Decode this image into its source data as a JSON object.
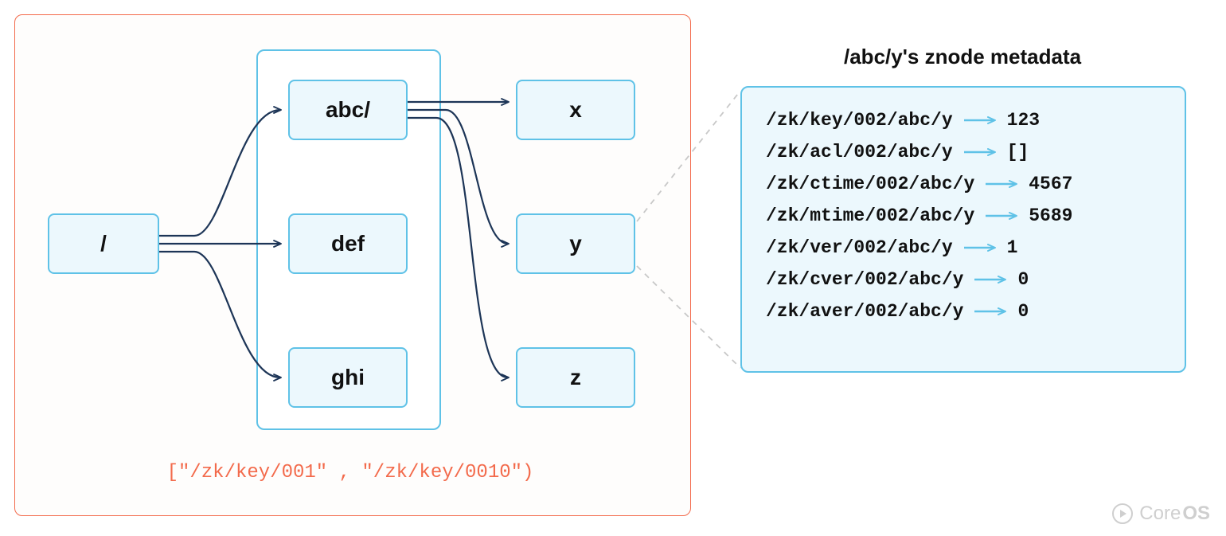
{
  "tree": {
    "root": {
      "label": "/"
    },
    "level1_frame_range": "[\"/zk/key/001\" , \"/zk/key/0010\")",
    "level1": [
      {
        "label": "abc/"
      },
      {
        "label": "def"
      },
      {
        "label": "ghi"
      }
    ],
    "level2": [
      {
        "label": "x"
      },
      {
        "label": "y"
      },
      {
        "label": "z"
      }
    ]
  },
  "metadata": {
    "title": "/abc/y's znode metadata",
    "rows": [
      {
        "key": "/zk/key/002/abc/y",
        "value": "123"
      },
      {
        "key": "/zk/acl/002/abc/y",
        "value": "[]"
      },
      {
        "key": "/zk/ctime/002/abc/y",
        "value": "4567"
      },
      {
        "key": "/zk/mtime/002/abc/y",
        "value": "5689"
      },
      {
        "key": "/zk/ver/002/abc/y",
        "value": "1"
      },
      {
        "key": "/zk/cver/002/abc/y",
        "value": "0"
      },
      {
        "key": "/zk/aver/002/abc/y",
        "value": "0"
      }
    ]
  },
  "branding": {
    "name_prefix": "Core",
    "name_suffix": "OS"
  },
  "colors": {
    "node_border": "#5fc2e7",
    "node_fill": "#ecf8fd",
    "frame_border": "#f36a4b",
    "arrow_dark": "#1d3557",
    "arrow_light": "#5fc2e7"
  }
}
